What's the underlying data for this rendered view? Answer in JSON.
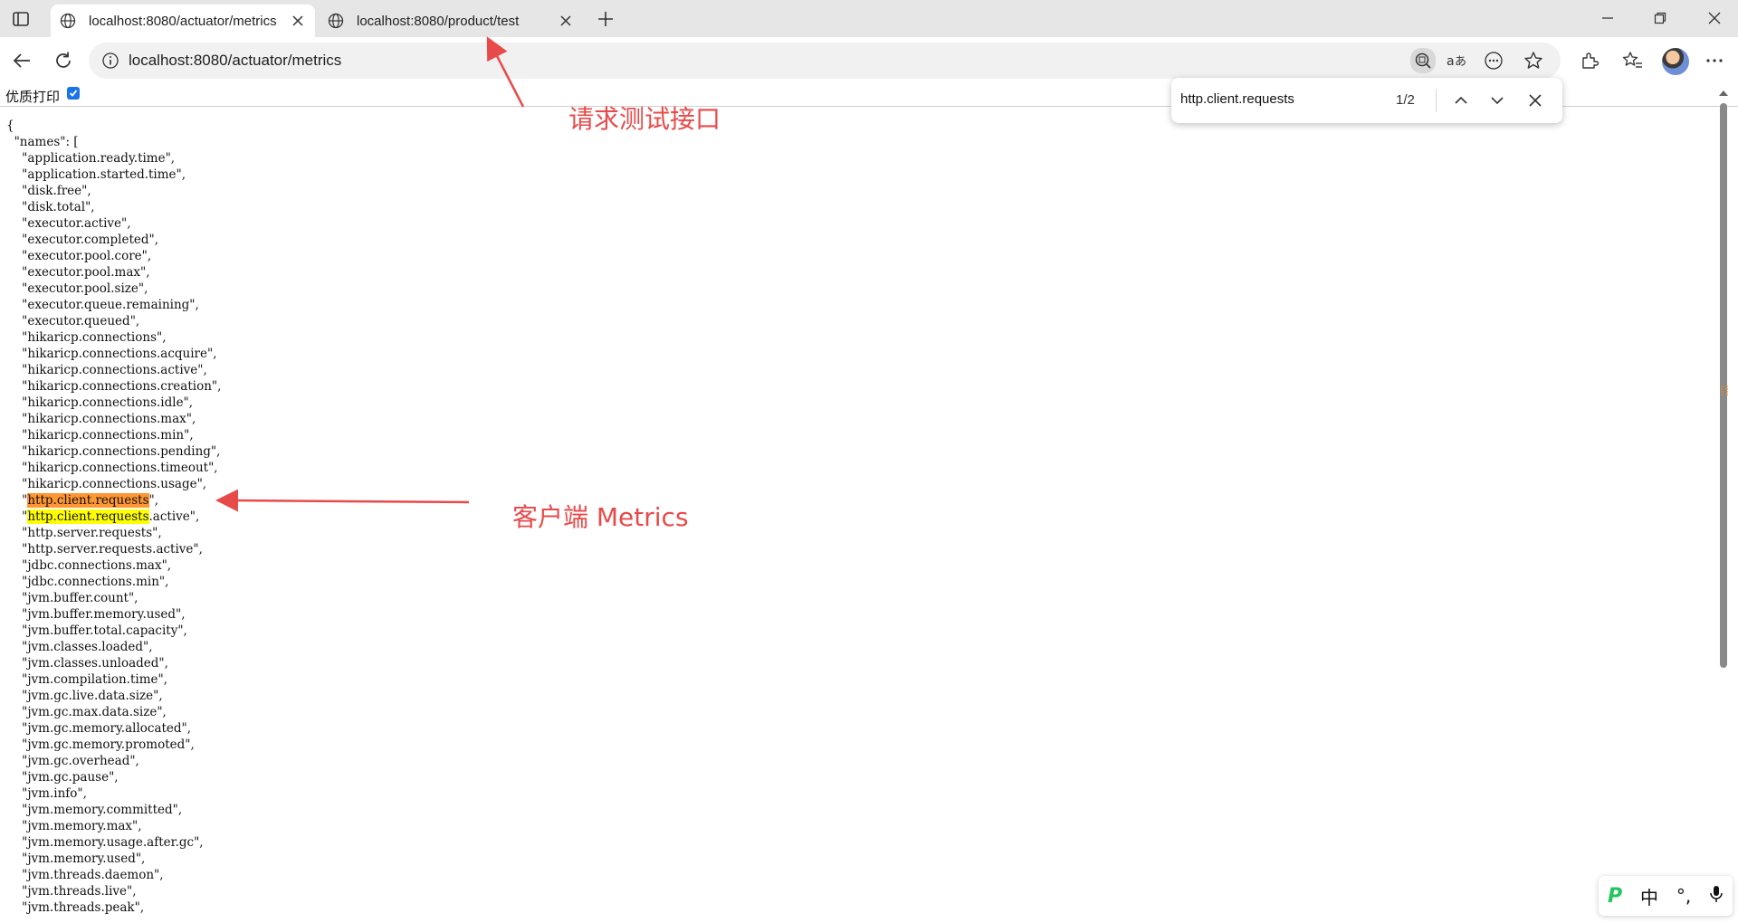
{
  "tabs": [
    {
      "title": "localhost:8080/actuator/metrics",
      "active": true
    },
    {
      "title": "localhost:8080/product/test",
      "active": false
    }
  ],
  "address": {
    "url": "localhost:8080/actuator/metrics"
  },
  "print_bar": {
    "label": "优质打印",
    "checked": true
  },
  "find": {
    "query": "http.client.requests",
    "count": "1/2"
  },
  "json_lines": [
    "{",
    "  \"names\": [",
    "    \"application.ready.time\",",
    "    \"application.started.time\",",
    "    \"disk.free\",",
    "    \"disk.total\",",
    "    \"executor.active\",",
    "    \"executor.completed\",",
    "    \"executor.pool.core\",",
    "    \"executor.pool.max\",",
    "    \"executor.pool.size\",",
    "    \"executor.queue.remaining\",",
    "    \"executor.queued\",",
    "    \"hikaricp.connections\",",
    "    \"hikaricp.connections.acquire\",",
    "    \"hikaricp.connections.active\",",
    "    \"hikaricp.connections.creation\",",
    "    \"hikaricp.connections.idle\",",
    "    \"hikaricp.connections.max\",",
    "    \"hikaricp.connections.min\",",
    "    \"hikaricp.connections.pending\",",
    "    \"hikaricp.connections.timeout\",",
    "    \"hikaricp.connections.usage\",",
    "    \"http.client.requests\",",
    "    \"http.client.requests.active\",",
    "    \"http.server.requests\",",
    "    \"http.server.requests.active\",",
    "    \"jdbc.connections.max\",",
    "    \"jdbc.connections.min\",",
    "    \"jvm.buffer.count\",",
    "    \"jvm.buffer.memory.used\",",
    "    \"jvm.buffer.total.capacity\",",
    "    \"jvm.classes.loaded\",",
    "    \"jvm.classes.unloaded\",",
    "    \"jvm.compilation.time\",",
    "    \"jvm.gc.live.data.size\",",
    "    \"jvm.gc.max.data.size\",",
    "    \"jvm.gc.memory.allocated\",",
    "    \"jvm.gc.memory.promoted\",",
    "    \"jvm.gc.overhead\",",
    "    \"jvm.gc.pause\",",
    "    \"jvm.info\",",
    "    \"jvm.memory.committed\",",
    "    \"jvm.memory.max\",",
    "    \"jvm.memory.usage.after.gc\",",
    "    \"jvm.memory.used\",",
    "    \"jvm.threads.daemon\",",
    "    \"jvm.threads.live\",",
    "    \"jvm.threads.peak\","
  ],
  "annotations": {
    "tab_note": "请求测试接口",
    "metric_note": "客户端 Metrics"
  },
  "ime": {
    "mode": "中",
    "punct": "°,"
  },
  "colors": {
    "annotation": "#e84a4a",
    "find_current": "#ff9632",
    "find_match": "#ffff00",
    "checkbox": "#1a73e8"
  },
  "icons": [
    "sidebar-icon",
    "globe-icon",
    "close-icon",
    "plus-icon",
    "minimize-icon",
    "maximize-icon",
    "back-icon",
    "refresh-icon",
    "info-icon",
    "read-aloud-icon",
    "translate-icon",
    "more-icon",
    "favorite-icon",
    "extensions-icon",
    "collections-icon",
    "chevron-up-icon",
    "chevron-down-icon",
    "microphone-icon"
  ]
}
